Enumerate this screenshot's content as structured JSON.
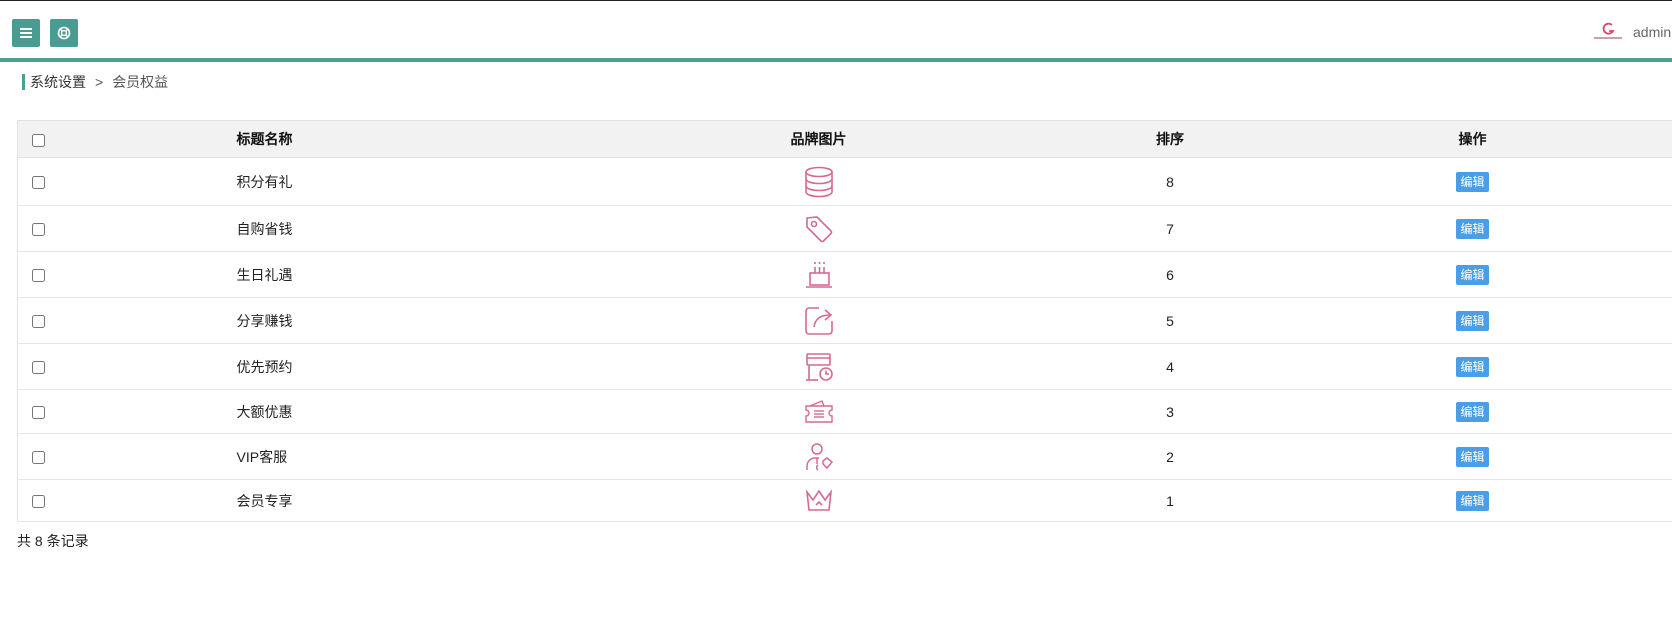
{
  "header": {
    "user_name": "admin",
    "accent_color": "#4e9e94",
    "button_color": "#4a9b91"
  },
  "breadcrumb": {
    "parent": "系统设置",
    "separator": ">",
    "current": "会员权益"
  },
  "table": {
    "headers": {
      "title": "标题名称",
      "image": "品牌图片",
      "sort": "排序",
      "action": "操作"
    },
    "rows": [
      {
        "title": "积分有礼",
        "icon": "database-coins-icon",
        "sort": "8",
        "action": "编辑"
      },
      {
        "title": "自购省钱",
        "icon": "price-tag-icon",
        "sort": "7",
        "action": "编辑"
      },
      {
        "title": "生日礼遇",
        "icon": "birthday-cake-icon",
        "sort": "6",
        "action": "编辑"
      },
      {
        "title": "分享赚钱",
        "icon": "share-arrow-icon",
        "sort": "5",
        "action": "编辑"
      },
      {
        "title": "优先预约",
        "icon": "calendar-clock-icon",
        "sort": "4",
        "action": "编辑"
      },
      {
        "title": "大额优惠",
        "icon": "coupon-ticket-icon",
        "sort": "3",
        "action": "编辑"
      },
      {
        "title": "VIP客服",
        "icon": "customer-service-icon",
        "sort": "2",
        "action": "编辑"
      },
      {
        "title": "会员专享",
        "icon": "crown-icon",
        "sort": "1",
        "action": "编辑"
      }
    ],
    "icon_color": "#d46a94",
    "edit_button_color": "#4a9ee8"
  },
  "footer": {
    "total_text": "共 8 条记录"
  }
}
